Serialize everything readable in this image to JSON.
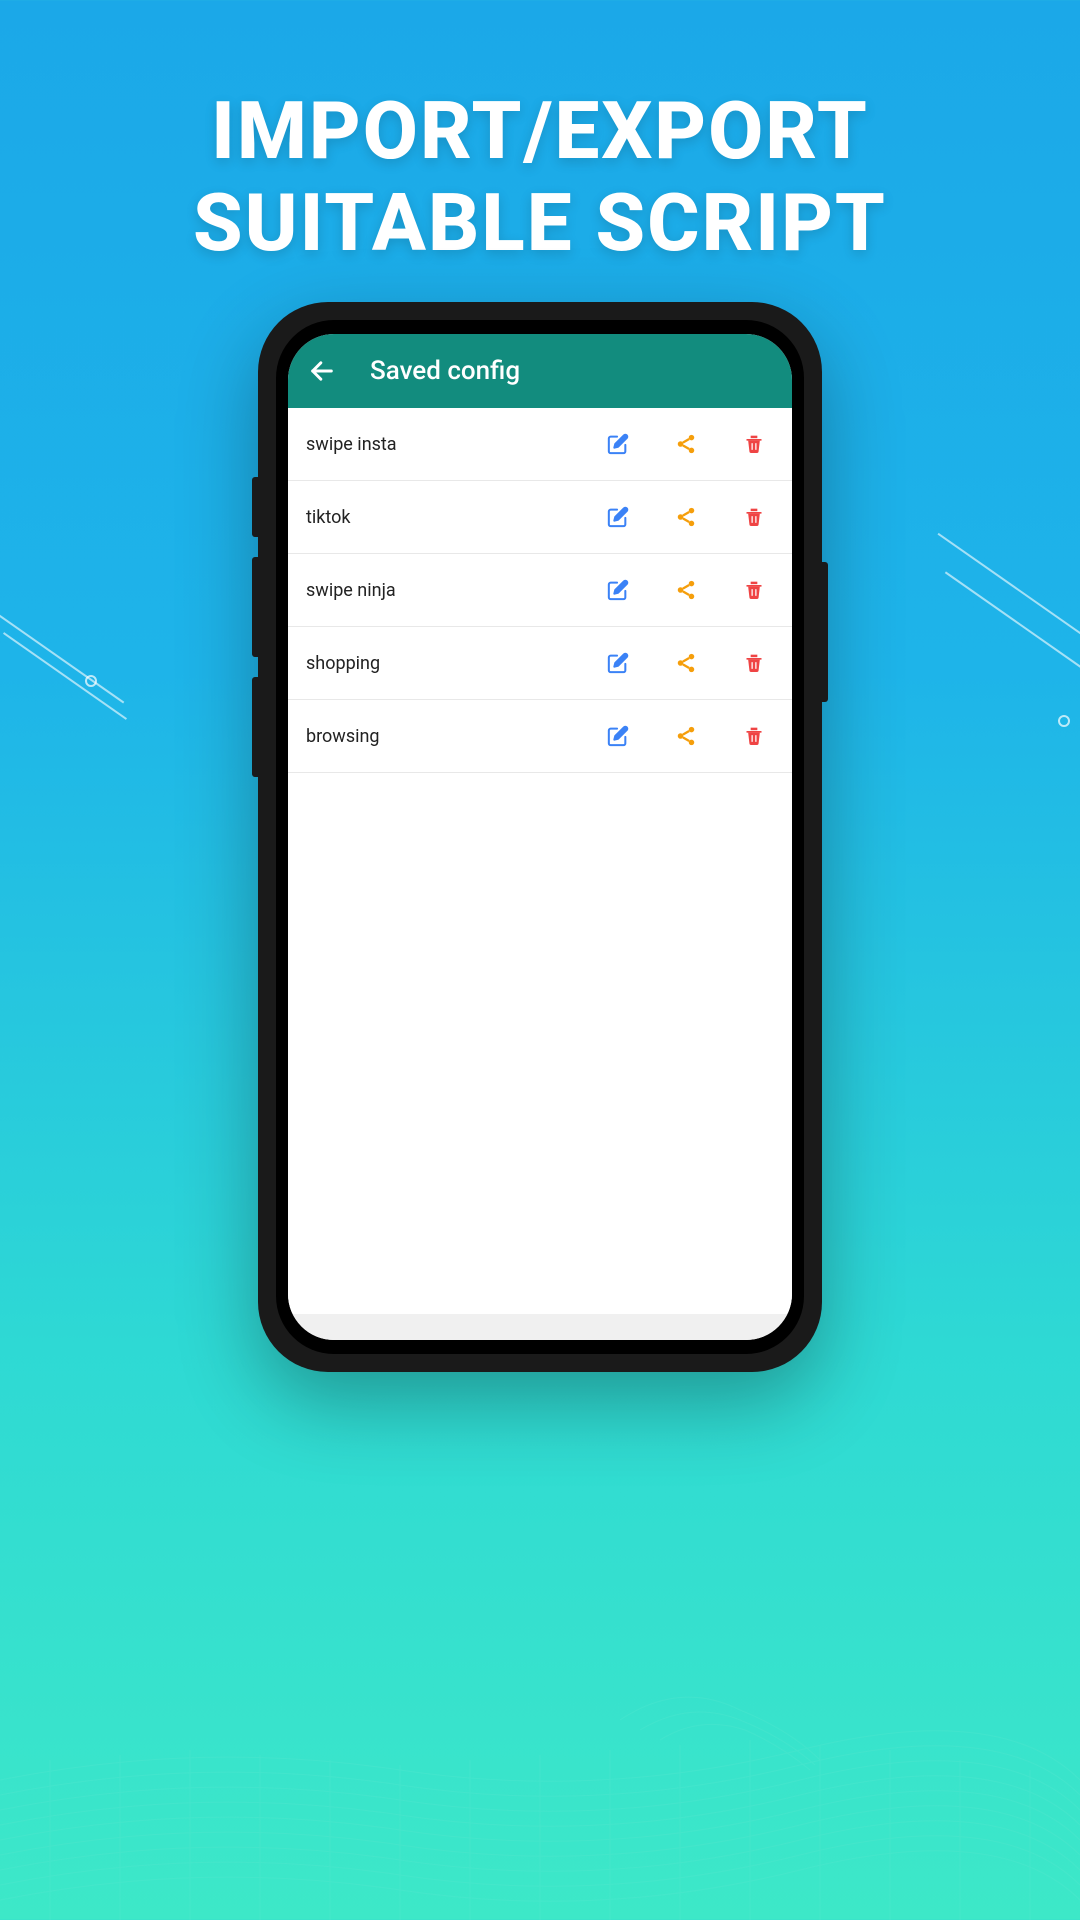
{
  "promo": {
    "line1": "IMPORT/EXPORT",
    "line2": "SUITABLE SCRIPT"
  },
  "app": {
    "header_title": "Saved config"
  },
  "configs": [
    {
      "name": "swipe insta"
    },
    {
      "name": "tiktok"
    },
    {
      "name": "swipe ninja"
    },
    {
      "name": "shopping"
    },
    {
      "name": "browsing"
    }
  ],
  "colors": {
    "header_bg": "#128c7e",
    "edit_icon": "#3b82f6",
    "share_icon": "#f59e0b",
    "delete_icon": "#ef4444"
  }
}
